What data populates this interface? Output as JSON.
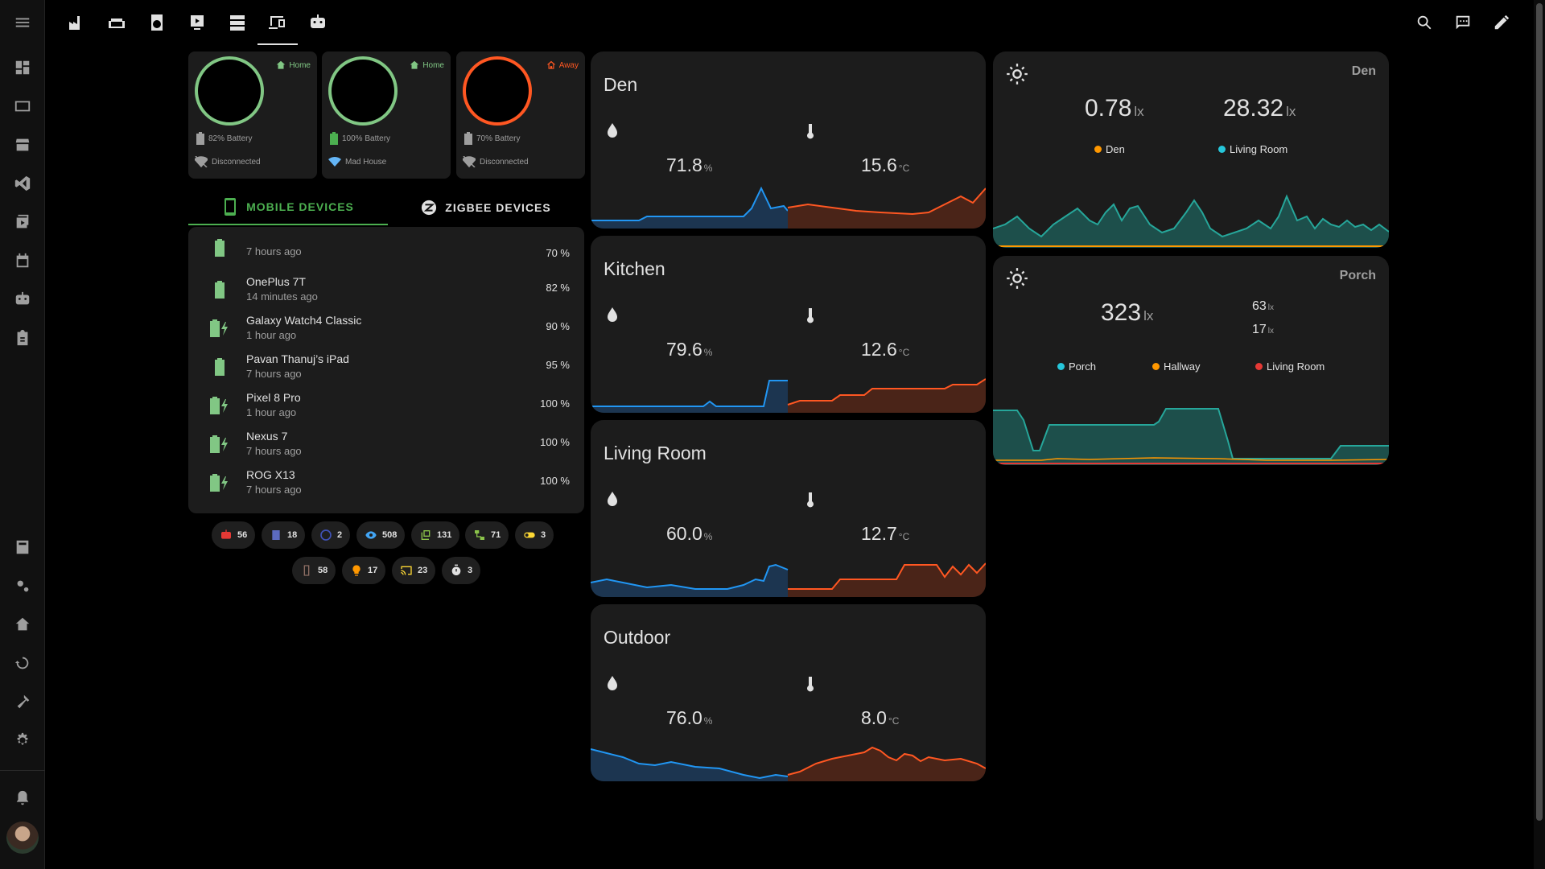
{
  "topbar": {
    "tabs": [
      "factory-icon",
      "sofa-icon",
      "washing-machine-icon",
      "monitor-icon",
      "server-icon",
      "devices-icon",
      "robot-icon"
    ],
    "actions": [
      "search-icon",
      "assist-icon",
      "pencil-icon"
    ]
  },
  "persons": [
    {
      "state": "Home",
      "battery": "82% Battery",
      "network": "Disconnected"
    },
    {
      "state": "Home",
      "battery": "100% Battery",
      "network": "Mad House"
    },
    {
      "state": "Away",
      "battery": "70% Battery",
      "network": "Disconnected"
    }
  ],
  "device_tabs": {
    "mobile": "MOBILE DEVICES",
    "zigbee": "ZIGBEE DEVICES"
  },
  "devices": [
    {
      "name": "",
      "time": "7 hours ago",
      "value": "70 %",
      "charging": false
    },
    {
      "name": "OnePlus 7T",
      "time": "14 minutes ago",
      "value": "82 %",
      "charging": false
    },
    {
      "name": "Galaxy Watch4 Classic",
      "time": "1 hour ago",
      "value": "90 %",
      "charging": true
    },
    {
      "name": "Pavan Thanuj’s iPad",
      "time": "7 hours ago",
      "value": "95 %",
      "charging": false
    },
    {
      "name": "Pixel 8 Pro",
      "time": "1 hour ago",
      "value": "100 %",
      "charging": true
    },
    {
      "name": "Nexus 7",
      "time": "7 hours ago",
      "value": "100 %",
      "charging": true
    },
    {
      "name": "ROG X13",
      "time": "7 hours ago",
      "value": "100 %",
      "charging": true
    }
  ],
  "badges": [
    {
      "icon": "robot-icon",
      "count": "56",
      "color": "#e53935"
    },
    {
      "icon": "book-icon",
      "count": "18",
      "color": "#5c6bc0"
    },
    {
      "icon": "palette-icon",
      "count": "2",
      "color": "#3f51b5"
    },
    {
      "icon": "eye-icon",
      "count": "508",
      "color": "#42a5f5"
    },
    {
      "icon": "copy-icon",
      "count": "131",
      "color": "#8bc34a"
    },
    {
      "icon": "lan-icon",
      "count": "71",
      "color": "#8bc34a"
    },
    {
      "icon": "toggle-icon",
      "count": "3",
      "color": "#fdd835"
    },
    {
      "icon": "remote-icon",
      "count": "58",
      "color": "#8d6e63"
    },
    {
      "icon": "bulb-icon",
      "count": "17",
      "color": "#ff9800"
    },
    {
      "icon": "cast-icon",
      "count": "23",
      "color": "#fdd835"
    },
    {
      "icon": "timer-icon",
      "count": "3",
      "color": "#e1e1e1"
    }
  ],
  "rooms": [
    {
      "name": "Den",
      "humidity": "71.8",
      "humidity_unit": "%",
      "temperature": "15.6",
      "temperature_unit": "°C"
    },
    {
      "name": "Kitchen",
      "humidity": "79.6",
      "humidity_unit": "%",
      "temperature": "12.6",
      "temperature_unit": "°C"
    },
    {
      "name": "Living Room",
      "humidity": "60.0",
      "humidity_unit": "%",
      "temperature": "12.7",
      "temperature_unit": "°C"
    },
    {
      "name": "Outdoor",
      "humidity": "76.0",
      "humidity_unit": "%",
      "temperature": "8.0",
      "temperature_unit": "°C"
    }
  ],
  "lights": [
    {
      "name": "Den",
      "values": [
        {
          "value": "0.78",
          "unit": "lx"
        },
        {
          "value": "28.32",
          "unit": "lx"
        }
      ],
      "legend": [
        {
          "label": "Den",
          "color": "#ff9800"
        },
        {
          "label": "Living Room",
          "color": "#26c6da"
        }
      ]
    },
    {
      "name": "Porch",
      "values": [
        {
          "value": "323",
          "unit": "lx"
        },
        {
          "value": "63",
          "unit": "lx"
        },
        {
          "value": "17",
          "unit": "lx"
        }
      ],
      "legend": [
        {
          "label": "Porch",
          "color": "#26c6da"
        },
        {
          "label": "Hallway",
          "color": "#ff9800"
        },
        {
          "label": "Living Room",
          "color": "#e53935"
        }
      ]
    }
  ],
  "colors": {
    "accent_green": "#4caf50",
    "home_green": "#81c784",
    "away_orange": "#ff5722",
    "humidity_blue": "#2196f3",
    "temp_orange": "#ff5722",
    "lux_teal": "#26a69a"
  }
}
